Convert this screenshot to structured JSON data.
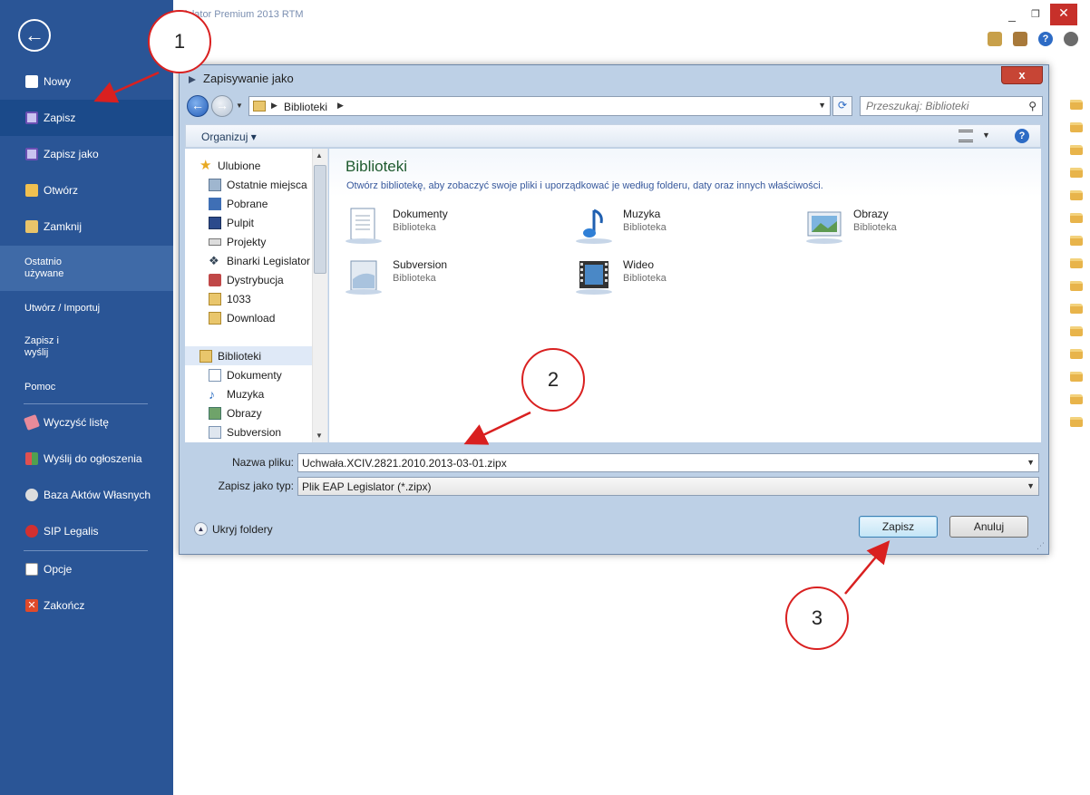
{
  "app": {
    "title": "Nie zapisany plik aktu prawnego - Legislator Premium 2013 RTM",
    "window_controls": {
      "minimize": "_",
      "restore": "❐",
      "close": "✕"
    }
  },
  "sidebar": {
    "back_icon": "←",
    "items": [
      {
        "label": "Nowy"
      },
      {
        "label": "Zapisz"
      },
      {
        "label": "Zapisz jako"
      },
      {
        "label": "Otwórz"
      },
      {
        "label": "Zamknij"
      },
      {
        "label": "Ostatnio\nużywane"
      },
      {
        "label": "Utwórz / Importuj"
      },
      {
        "label": "Zapisz i\nwyślij"
      },
      {
        "label": "Pomoc"
      },
      {
        "label": "Wyczyść listę"
      },
      {
        "label": "Wyślij do ogłoszenia"
      },
      {
        "label": "Baza Aktów Własnych"
      },
      {
        "label": "SIP Legalis"
      },
      {
        "label": "Opcje"
      },
      {
        "label": "Zakończ"
      }
    ]
  },
  "dialog": {
    "title": "Zapisywanie jako",
    "close": "x",
    "breadcrumb": "Biblioteki",
    "search_placeholder": "Przeszukaj: Biblioteki",
    "organize": "Organizuj ▾",
    "help": "?",
    "nav_pane": {
      "favorites": "Ulubione",
      "favorites_items": [
        "Ostatnie miejsca",
        "Pobrane",
        "Pulpit",
        "Projekty",
        "Binarki Legislator",
        "Dystrybucja",
        "1033",
        "Download"
      ],
      "libraries": "Biblioteki",
      "libraries_items": [
        "Dokumenty",
        "Muzyka",
        "Obrazy",
        "Subversion"
      ]
    },
    "content": {
      "title": "Biblioteki",
      "description": "Otwórz bibliotekę, aby zobaczyć swoje pliki i uporządkować je według folderu, daty oraz innych właściwości.",
      "libraries": [
        {
          "name": "Dokumenty",
          "type": "Biblioteka"
        },
        {
          "name": "Muzyka",
          "type": "Biblioteka"
        },
        {
          "name": "Obrazy",
          "type": "Biblioteka"
        },
        {
          "name": "Subversion",
          "type": "Biblioteka"
        },
        {
          "name": "Wideo",
          "type": "Biblioteka"
        }
      ]
    },
    "filename_label": "Nazwa pliku:",
    "filename_value": "Uchwała.XCIV.2821.2010.2013-03-01.zipx",
    "filetype_label": "Zapisz jako typ:",
    "filetype_value": "Plik EAP Legislator (*.zipx)",
    "hide_folders": "Ukryj foldery",
    "save_button": "Zapisz",
    "cancel_button": "Anuluj"
  },
  "annotations": [
    "1",
    "2",
    "3"
  ],
  "colors": {
    "sidebar_bg": "#2a5596",
    "annotation": "#d92020",
    "library_title": "#1e5a2e"
  }
}
